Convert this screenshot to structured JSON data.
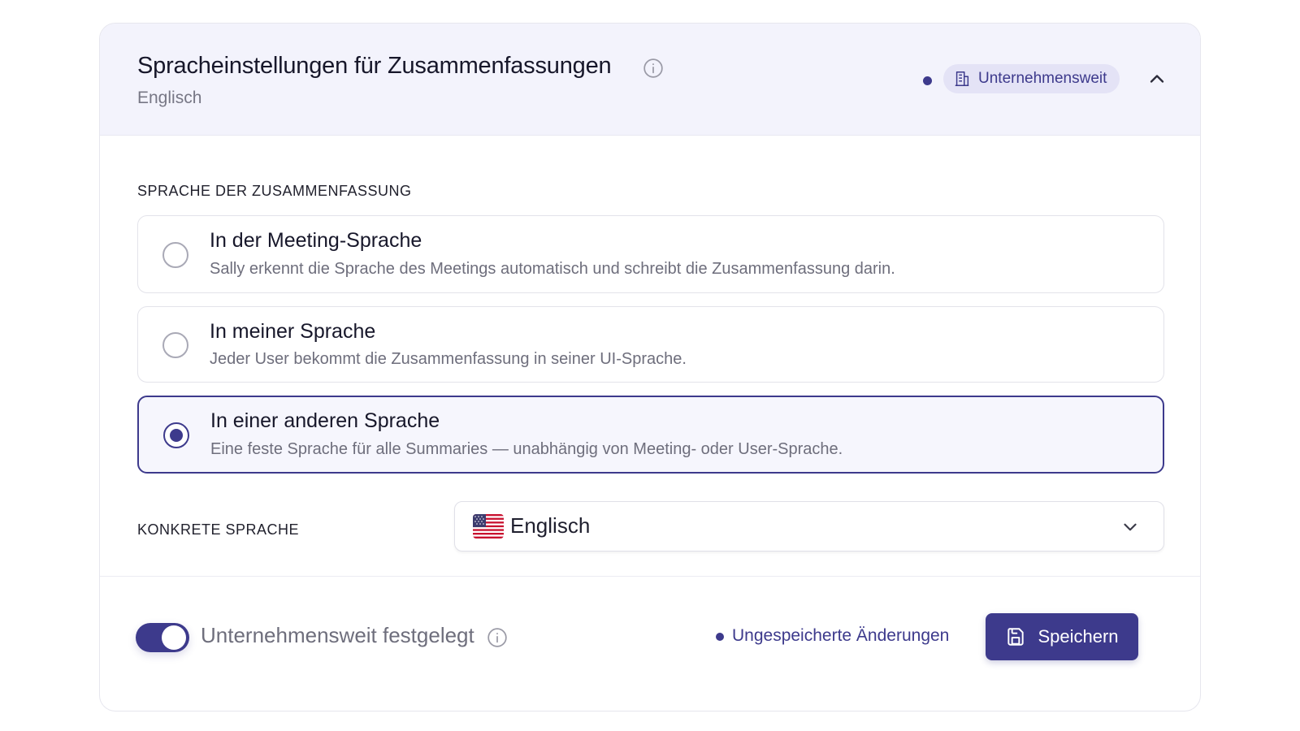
{
  "header": {
    "title": "Spracheinstellungen für Zusammenfassungen",
    "subtitle": "Englisch",
    "scope_badge": "Unternehmensweit",
    "title_info_icon": "info-icon",
    "scope_icon": "building-icon",
    "collapse_icon": "chevron-up-icon"
  },
  "section_label": "SPRACHE DER ZUSAMMENFASSUNG",
  "options": [
    {
      "title": "In der Meeting-Sprache",
      "description": "Sally erkennt die Sprache des Meetings automatisch und schreibt die Zusammenfassung darin.",
      "selected": false
    },
    {
      "title": "In meiner Sprache",
      "description": "Jeder User bekommt die Zusammenfassung in seiner UI-Sprache.",
      "selected": false
    },
    {
      "title": "In einer anderen Sprache",
      "description": "Eine feste Sprache für alle Summaries — unabhängig von Meeting- oder User-Sprache.",
      "selected": true
    }
  ],
  "language": {
    "label": "KONKRETE SPRACHE",
    "selected_value": "Englisch",
    "flag_icon": "us-flag-icon",
    "dropdown_icon": "chevron-down-icon"
  },
  "footer": {
    "toggle_label": "Unternehmensweit festgelegt",
    "toggle_on": true,
    "unsaved_text": "Ungespeicherte Änderungen",
    "save_label": "Speichern",
    "save_icon": "floppy-disk-icon"
  },
  "colors": {
    "accent": "#3d3a8c",
    "header_bg": "#f3f3fc",
    "badge_bg": "#e4e3f6",
    "text_primary": "#17172a",
    "text_muted": "#6e6e7c"
  }
}
